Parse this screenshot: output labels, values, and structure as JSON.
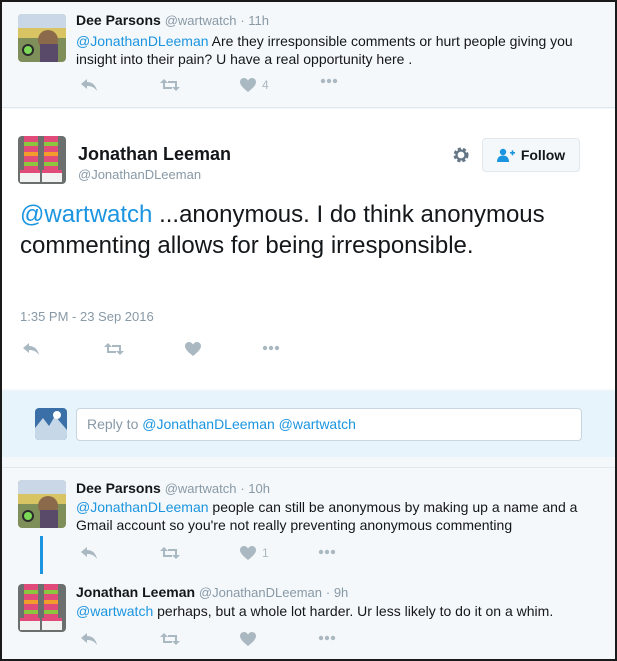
{
  "tweet1": {
    "name": "Dee Parsons",
    "handle": "@wartwatch",
    "time": "· 11h",
    "mention": "@JonathanDLeeman",
    "text": " Are they irresponsible comments or hurt people giving you insight into their pain? U have a real opportunity here .",
    "likes": "4"
  },
  "main": {
    "name": "Jonathan Leeman",
    "handle": "@JonathanDLeeman",
    "follow_label": "Follow",
    "mention": "@wartwatch",
    "text": " ...anonymous. I do think anonymous commenting allows for being irresponsible.",
    "timestamp": "1:35 PM - 23 Sep 2016"
  },
  "reply": {
    "prefix": "Reply to ",
    "mentions": "@JonathanDLeeman @wartwatch"
  },
  "tweet2": {
    "name": "Dee Parsons",
    "handle": "@wartwatch",
    "time": "· 10h",
    "mention": "@JonathanDLeeman",
    "text": " people can still be anonymous by making up a name and a Gmail account so you're not really preventing anonymous commenting",
    "likes": "1"
  },
  "tweet3": {
    "name": "Jonathan Leeman",
    "handle": "@JonathanDLeeman",
    "time": "· 9h",
    "mention": "@wartwatch",
    "text": " perhaps, but a whole lot harder. Ur less likely to do it on a whim."
  },
  "colors": {
    "link": "#1b95e0",
    "muted": "#aab8c2",
    "reply_bg": "#e8f4fb"
  },
  "icons": [
    "reply-icon",
    "retweet-icon",
    "like-icon",
    "more-icon",
    "gear-icon",
    "follow-person-icon"
  ]
}
